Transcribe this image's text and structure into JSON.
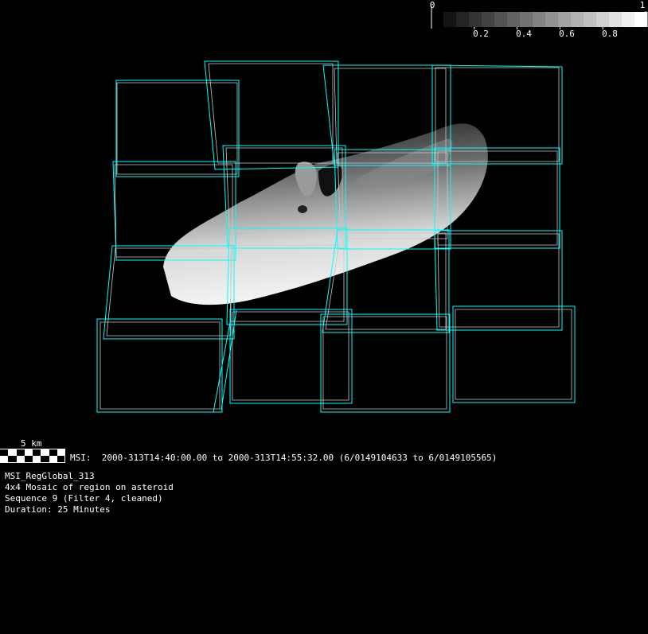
{
  "colorbar": {
    "min_label": "0",
    "max_label": "1",
    "ticks": [
      "0.2",
      "0.4",
      "0.6",
      "0.8"
    ],
    "tick_values": [
      0.2,
      0.4,
      0.6,
      0.8
    ],
    "steps": 16
  },
  "scale_bar": {
    "label": "5 km"
  },
  "observation": {
    "time_range": "MSI:  2000-313T14:40:00.00 to 2000-313T14:55:32.00 (6/0149104633 to 6/0149105565)"
  },
  "info": {
    "sequence_name": "MSI_RegGlobal_313",
    "description": "4x4 Mosaic of region on asteroid",
    "sequence": "Sequence 9 (Filter 4, cleaned)",
    "duration": "Duration: 25 Minutes"
  },
  "colors": {
    "footprint": "#00ffff",
    "footprint_alt": "#c8c8c8",
    "background": "#000000"
  }
}
